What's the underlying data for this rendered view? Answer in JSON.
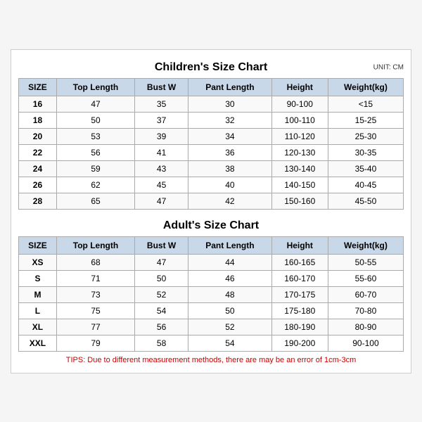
{
  "children_title": "Children's Size Chart",
  "adults_title": "Adult's Size Chart",
  "unit": "UNIT: CM",
  "headers": [
    "SIZE",
    "Top Length",
    "Bust W",
    "Pant Length",
    "Height",
    "Weight(kg)"
  ],
  "children_rows": [
    [
      "16",
      "47",
      "35",
      "30",
      "90-100",
      "<15"
    ],
    [
      "18",
      "50",
      "37",
      "32",
      "100-110",
      "15-25"
    ],
    [
      "20",
      "53",
      "39",
      "34",
      "110-120",
      "25-30"
    ],
    [
      "22",
      "56",
      "41",
      "36",
      "120-130",
      "30-35"
    ],
    [
      "24",
      "59",
      "43",
      "38",
      "130-140",
      "35-40"
    ],
    [
      "26",
      "62",
      "45",
      "40",
      "140-150",
      "40-45"
    ],
    [
      "28",
      "65",
      "47",
      "42",
      "150-160",
      "45-50"
    ]
  ],
  "adult_rows": [
    [
      "XS",
      "68",
      "47",
      "44",
      "160-165",
      "50-55"
    ],
    [
      "S",
      "71",
      "50",
      "46",
      "160-170",
      "55-60"
    ],
    [
      "M",
      "73",
      "52",
      "48",
      "170-175",
      "60-70"
    ],
    [
      "L",
      "75",
      "54",
      "50",
      "175-180",
      "70-80"
    ],
    [
      "XL",
      "77",
      "56",
      "52",
      "180-190",
      "80-90"
    ],
    [
      "XXL",
      "79",
      "58",
      "54",
      "190-200",
      "90-100"
    ]
  ],
  "tips": "TIPS: Due to different measurement methods, there are may be an error of 1cm-3cm"
}
